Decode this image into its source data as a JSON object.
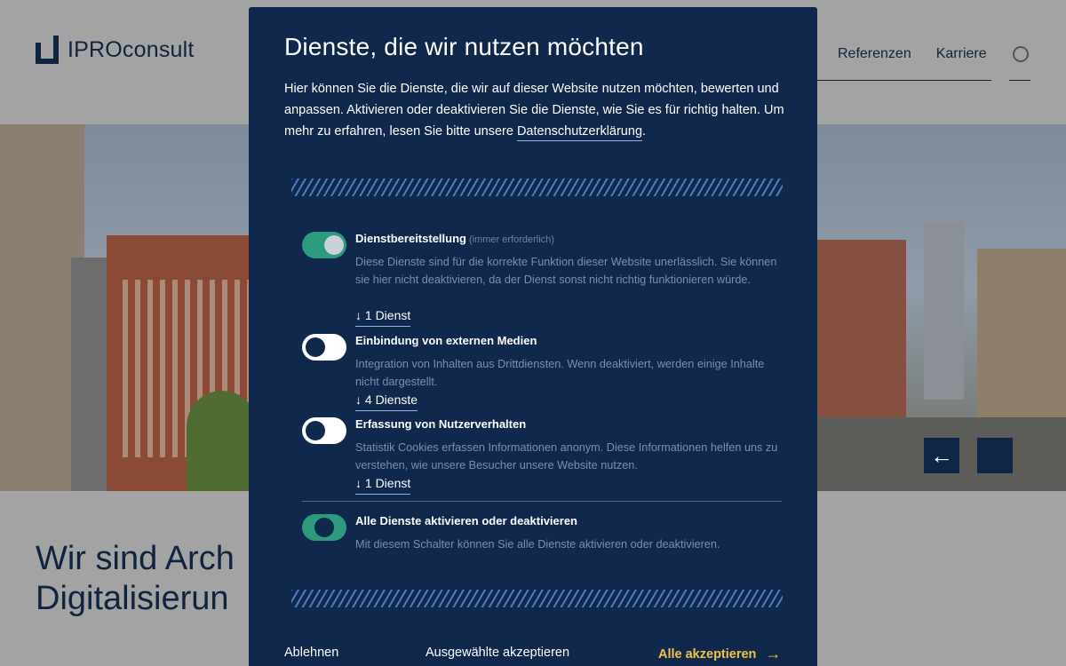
{
  "header": {
    "logo_text": "IPROconsult",
    "nav": [
      "Referenzen",
      "Karriere"
    ]
  },
  "hero": {
    "heading_line1": "Wir sind Arch",
    "heading_line2": "Digitalisierun",
    "prev_icon": "arrow-left-icon"
  },
  "modal": {
    "title": "Dienste, die wir nutzen möchten",
    "description": "Hier können Sie die Dienste, die wir auf dieser Website nutzen möchten, bewerten und anpassen. Aktivieren oder deaktivieren Sie die Dienste, wie Sie es für richtig halten. Um mehr zu erfahren, lesen Sie bitte unsere ",
    "privacy_link": "Datenschutzerklärung",
    "description_end": ".",
    "services": [
      {
        "title": "Dienstbereitstellung",
        "note": "(immer erforderlich)",
        "description": "Diese Dienste sind für die korrekte Funktion dieser Website unerlässlich. Sie können sie hier nicht deaktivieren, da der Dienst sonst nicht richtig funktionieren würde.",
        "count": "↓ 1 Dienst",
        "state": "on"
      },
      {
        "title": "Einbindung von externen Medien",
        "description": "Integration von Inhalten aus Drittdiensten. Wenn deaktiviert, werden einige Inhalte nicht dargestellt.",
        "count": "↓ 4 Dienste",
        "state": "off"
      },
      {
        "title": "Erfassung von Nutzerverhalten",
        "description": "Statistik Cookies erfassen Informationen anonym. Diese Informationen helfen uns zu verstehen, wie unsere Besucher unsere Website nutzen.",
        "count": "↓ 1 Dienst",
        "state": "off"
      }
    ],
    "all_toggle": {
      "title": "Alle Dienste aktivieren oder deaktivieren",
      "description": "Mit diesem Schalter können Sie alle Dienste aktivieren oder deaktivieren.",
      "state": "mixed"
    },
    "buttons": {
      "decline": "Ablehnen",
      "accept_selected": "Ausgewählte akzeptieren",
      "accept_all": "Alle akzeptieren",
      "accept_all_icon": "→"
    }
  },
  "colors": {
    "modal_bg": "#10284c",
    "toggle_on": "#2b9a7f",
    "accent": "#f0c344"
  }
}
